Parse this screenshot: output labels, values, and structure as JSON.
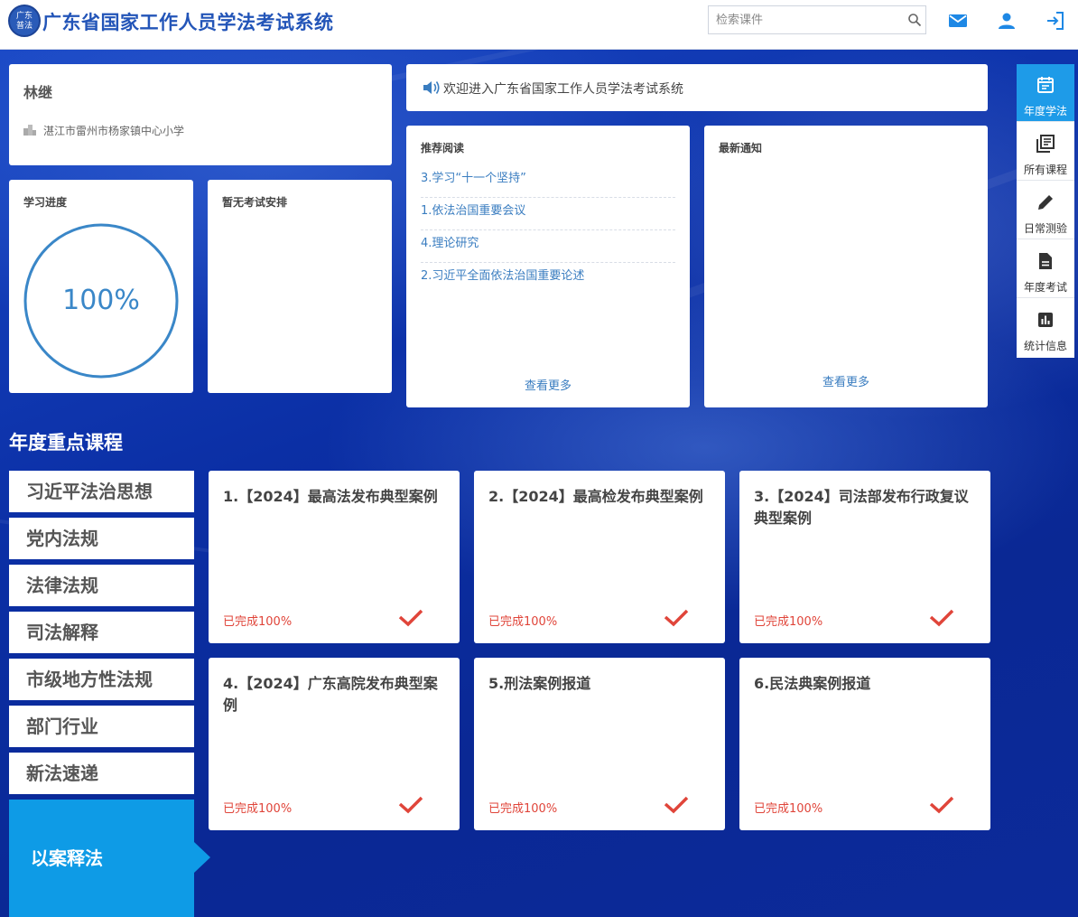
{
  "header": {
    "logo_text": [
      "广东",
      "普法"
    ],
    "title": "广东省国家工作人员学法考试系统",
    "search": {
      "placeholder": "检索课件"
    },
    "icons": [
      "mail-icon",
      "user-icon",
      "logout-icon"
    ]
  },
  "user": {
    "name": "林继",
    "org": "湛江市雷州市杨家镇中心小学"
  },
  "progress": {
    "title": "学习进度",
    "value": 100,
    "label": "100%"
  },
  "exam": {
    "title": "暂无考试安排"
  },
  "notice_bar": {
    "text": "欢迎进入广东省国家工作人员学法考试系统"
  },
  "reading": {
    "title": "推荐阅读",
    "items": [
      "3.学习“十一个坚持”",
      "1.依法治国重要会议",
      "4.理论研究",
      "2.习近平全面依法治国重要论述"
    ],
    "more": "查看更多"
  },
  "notices": {
    "title": "最新通知",
    "more": "查看更多"
  },
  "right_nav": [
    {
      "label": "年度学法",
      "icon": "calendar-icon",
      "active": true
    },
    {
      "label": "所有课程",
      "icon": "library-icon",
      "active": false
    },
    {
      "label": "日常测验",
      "icon": "pencil-icon",
      "active": false
    },
    {
      "label": "年度考试",
      "icon": "document-icon",
      "active": false
    },
    {
      "label": "统计信息",
      "icon": "chart-icon",
      "active": false
    }
  ],
  "section": {
    "title": "年度重点课程",
    "categories": [
      "习近平法治思想",
      "党内法规",
      "法律法规",
      "司法解释",
      "市级地方性法规",
      "部门行业",
      "新法速递",
      "以案释法"
    ],
    "active_category": "以案释法"
  },
  "courses": [
    {
      "title": "1.【2024】最高法发布典型案例",
      "progress": "已完成100%"
    },
    {
      "title": "2.【2024】最高检发布典型案例",
      "progress": "已完成100%"
    },
    {
      "title": "3.【2024】司法部发布行政复议典型案例",
      "progress": "已完成100%"
    },
    {
      "title": "4.【2024】广东高院发布典型案例",
      "progress": "已完成100%"
    },
    {
      "title": "5.刑法案例报道",
      "progress": "已完成100%"
    },
    {
      "title": "6.民法典案例报道",
      "progress": "已完成100%"
    }
  ],
  "colors": {
    "brand_blue": "#2355b8",
    "accent": "#1e9be8",
    "link": "#3a7dc0",
    "complete": "#e0453a"
  }
}
